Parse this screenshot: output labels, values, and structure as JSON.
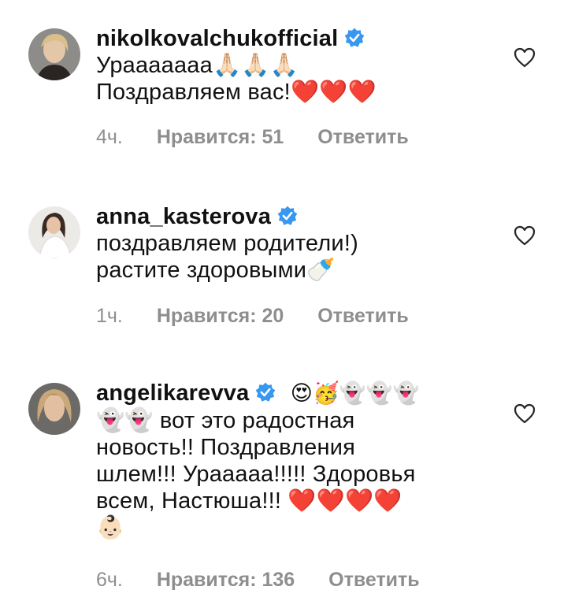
{
  "comments": [
    {
      "username": "nikolkovalchuk​official",
      "lines": [
        "Урааааааа🙏🏻🙏🏻🙏🏻",
        "Поздравляем вас!❤️❤️❤️"
      ],
      "time": "4ч.",
      "likes": "Нравится: 51",
      "reply": "Ответить"
    },
    {
      "username": "anna_kasterova",
      "lines": [
        "поздравляем родители!)",
        "растите здоровыми🍼"
      ],
      "time": "1ч.",
      "likes": "Нравится: 20",
      "reply": "Ответить"
    },
    {
      "username": "angelikarevva",
      "emojis_after_name": "😍🥳👻👻👻",
      "lines": [
        "👻👻 вот это радостная",
        "новость!! Поздравления",
        "шлем!!! Урааааа!!!!! Здоровья",
        "всем, Настюша!!! ❤️❤️❤️❤️",
        "👶🏻"
      ],
      "time": "6ч.",
      "likes": "Нравится: 136",
      "reply": "Ответить"
    }
  ],
  "colors": {
    "verified": "#3897f0",
    "meta": "#8e8e8e",
    "heart_stroke": "#262626"
  }
}
